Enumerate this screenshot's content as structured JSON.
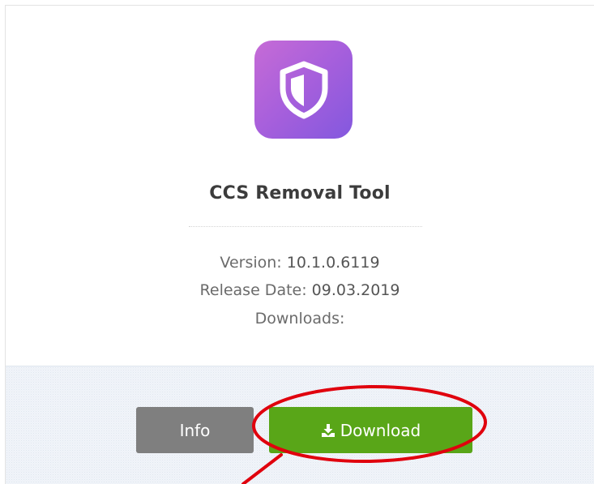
{
  "app": {
    "name": "CCS Removal Tool",
    "version_label": "Version:",
    "version_value": "10.1.0.6119",
    "release_label": "Release Date:",
    "release_value": "09.03.2019",
    "downloads_label": "Downloads:",
    "downloads_value": ""
  },
  "actions": {
    "info_label": "Info",
    "download_label": "Download"
  },
  "icons": {
    "app_icon": "shield-icon",
    "download_icon": "download-icon"
  },
  "colors": {
    "download_button": "#59a618",
    "info_button": "#7f7f7f",
    "icon_gradient_start": "#c66bd6",
    "icon_gradient_end": "#8358de",
    "annotation": "#e0000d"
  }
}
